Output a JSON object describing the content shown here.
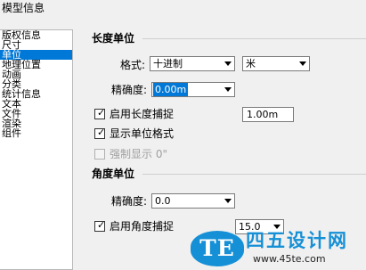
{
  "window": {
    "title": "模型信息"
  },
  "sidebar": {
    "items": [
      {
        "label": "版权信息",
        "selected": false
      },
      {
        "label": "尺寸",
        "selected": false
      },
      {
        "label": "单位",
        "selected": true
      },
      {
        "label": "地理位置",
        "selected": false
      },
      {
        "label": "动画",
        "selected": false
      },
      {
        "label": "分类",
        "selected": false
      },
      {
        "label": "统计信息",
        "selected": false
      },
      {
        "label": "文本",
        "selected": false
      },
      {
        "label": "文件",
        "selected": false
      },
      {
        "label": "渲染",
        "selected": false
      },
      {
        "label": "组件",
        "selected": false
      }
    ]
  },
  "length_units": {
    "title": "长度单位",
    "format_label": "格式:",
    "format_value": "十进制",
    "unit_value": "米",
    "precision_label": "精确度:",
    "precision_value": "0.00m",
    "snap_label": "启用长度捕捉",
    "snap_checked": true,
    "snap_value": "1.00m",
    "show_format_label": "显示单位格式",
    "show_format_checked": true,
    "force_label": "强制显示 0\"",
    "force_checked": false,
    "force_enabled": false
  },
  "angle_units": {
    "title": "角度单位",
    "precision_label": "精确度:",
    "precision_value": "0.0",
    "snap_label": "启用角度捕捉",
    "snap_checked": true,
    "snap_value": "15.0"
  },
  "watermark": {
    "badge": "TE",
    "name": "四五设计网",
    "url": "www.45te.com"
  },
  "colors": {
    "selection": "#0078d7",
    "panel": "#f0f0f0",
    "watermark_blue": "#1590d6"
  }
}
